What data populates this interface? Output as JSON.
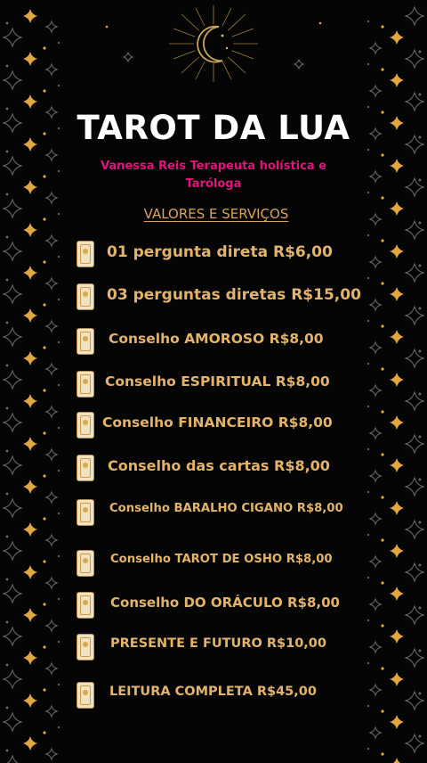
{
  "header": {
    "title": "TAROT DA LUA",
    "subtitle": "Vanessa Reis Terapeuta holística e Taróloga",
    "section_title": "VALORES E SERVIÇOS"
  },
  "services": [
    {
      "label": "01 pergunta direta R$6,00"
    },
    {
      "label": "03 perguntas diretas R$15,00"
    },
    {
      "label": "Conselho AMOROSO R$8,00"
    },
    {
      "label": "Conselho ESPIRITUAL R$8,00"
    },
    {
      "label": "Conselho FINANCEIRO R$8,00"
    },
    {
      "label": "Conselho das cartas R$8,00"
    },
    {
      "label": "Conselho BARALHO CIGANO R$8,00"
    },
    {
      "label": "Conselho TAROT DE OSHO R$8,00"
    },
    {
      "label": "Conselho DO ORÁCULO R$8,00"
    },
    {
      "label": "PRESENTE E FUTURO R$10,00"
    },
    {
      "label": "LEITURA COMPLETA R$45,00"
    }
  ],
  "colors": {
    "background": "#050505",
    "title": "#ffffff",
    "subtitle": "#e0147c",
    "accent_gold": "#e3b36a"
  },
  "icons": {
    "emblem": "crescent-moon-icon",
    "item_bullet": "tarot-card-icon",
    "decor": "sparkle-star-icon"
  }
}
